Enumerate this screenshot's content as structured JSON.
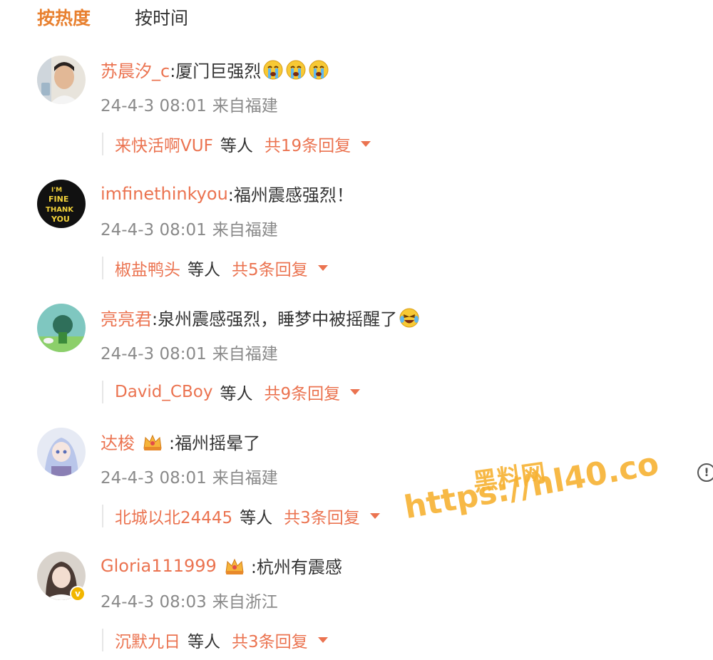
{
  "tabs": [
    {
      "label": "按热度",
      "active": true
    },
    {
      "label": "按时间",
      "active": false
    }
  ],
  "comments": [
    {
      "user": "苏晨汐_c",
      "text": ":厦门巨强烈",
      "emojis": [
        "crying-face-icon",
        "crying-face-icon",
        "crying-face-icon"
      ],
      "time": "24-4-3 08:01",
      "location": "来自福建",
      "top_replier": "来快活啊VUF",
      "deng": "等人",
      "reply_total": "共19条回复"
    },
    {
      "user": "imfinethinkyou",
      "text": ":福州震感强烈！",
      "avatar_text": [
        "I'M",
        "FINE",
        "THANK",
        "YOU"
      ],
      "time": "24-4-3 08:01",
      "location": "来自福建",
      "top_replier": "椒盐鸭头",
      "deng": "等人",
      "reply_total": "共5条回复"
    },
    {
      "user": "亮亮君",
      "text": ":泉州震感强烈，睡梦中被摇醒了",
      "emojis": [
        "laughing-crying-face-icon"
      ],
      "time": "24-4-3 08:01",
      "location": "来自福建",
      "top_replier": "David_CBoy",
      "deng": "等人",
      "reply_total": "共9条回复"
    },
    {
      "user": "达梭",
      "badge": "crown-badge-icon",
      "text": ":福州摇晕了",
      "time": "24-4-3 08:01",
      "location": "来自福建",
      "top_replier": "北城以北24445",
      "deng": "等人",
      "reply_total": "共3条回复"
    },
    {
      "user": "Gloria111999",
      "badge": "crown-badge-icon",
      "verified": true,
      "text": ":杭州有震感",
      "time": "24-4-3 08:03",
      "location": "来自浙江",
      "top_replier": "沉默九日",
      "deng": "等人",
      "reply_total": "共3条回复"
    }
  ],
  "watermark": {
    "line1": "黑料网",
    "line2": "https://hl40.co"
  },
  "report_icon": "!",
  "colors": {
    "accent": "#eb7350",
    "active_tab": "#e8802f",
    "watermark": "#f7b233",
    "meta": "#8a8a8a"
  }
}
